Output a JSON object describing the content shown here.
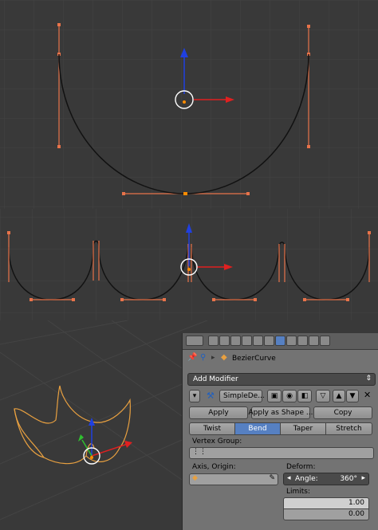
{
  "object_name": "BezierCurve",
  "add_modifier_label": "Add Modifier",
  "modifier": {
    "name": "SimpleDe...",
    "apply_label": "Apply",
    "apply_as_shape_label": "Apply as Shape ...",
    "copy_label": "Copy"
  },
  "deform_tabs": [
    "Twist",
    "Bend",
    "Taper",
    "Stretch"
  ],
  "active_tab": "Bend",
  "vertex_group_label": "Vertex Group:",
  "axis_origin_label": "Axis, Origin:",
  "deform_label": "Deform:",
  "angle_label": "Angle:",
  "angle_value": "360°",
  "limits_label": "Limits:",
  "limits": [
    "1.00",
    "0.00"
  ],
  "colors": {
    "curve": "#111111",
    "handle": "#e8734a",
    "selected_handle": "#ff8c00",
    "axis_x": "#e02020",
    "axis_y": "#2040e0",
    "axis_z": "#30c030",
    "active_tab": "#5680c2",
    "object_outline": "#e8a040"
  }
}
